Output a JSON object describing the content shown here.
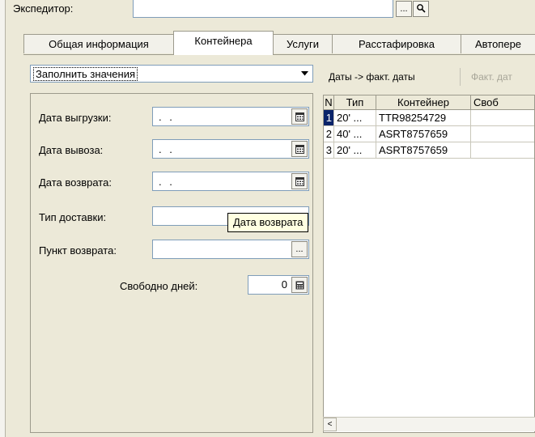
{
  "top": {
    "label": "Экспедитор:",
    "dots_btn": "...",
    "search_icon": "search-icon"
  },
  "tabs": [
    {
      "label": "Общая информация",
      "active": false
    },
    {
      "label": "Контейнера",
      "active": true
    },
    {
      "label": "Услуги",
      "active": false
    },
    {
      "label": "Расстафировка",
      "active": false
    },
    {
      "label": "Автопере",
      "active": false
    }
  ],
  "fill_values": {
    "label": "Заполнить значения"
  },
  "fields": {
    "unload_date": {
      "label": "Дата выгрузки:",
      "value": ". ."
    },
    "export_date": {
      "label": "Дата вывоза:",
      "value": ". ."
    },
    "return_date": {
      "label": "Дата возврата:",
      "value": ". ."
    },
    "delivery_type": {
      "label": "Тип доставки:",
      "value": ""
    },
    "return_point": {
      "label": "Пункт возврата:",
      "value": "",
      "dots": "..."
    },
    "free_days": {
      "label": "Свободно дней:",
      "value": "0"
    }
  },
  "toolbar": {
    "dates_to_fact": "Даты -> факт. даты",
    "fact_dates": "Факт. дат"
  },
  "table": {
    "columns": [
      "N",
      "Тип",
      "Контейнер",
      "Своб"
    ],
    "rows": [
      {
        "n": "1",
        "type": "20' ...",
        "container": "TTR98254729",
        "free": ""
      },
      {
        "n": "2",
        "type": "40' ...",
        "container": "ASRT8757659",
        "free": ""
      },
      {
        "n": "3",
        "type": "20' ...",
        "container": "ASRT8757659",
        "free": ""
      }
    ],
    "scroll_left": "<"
  },
  "tooltip": {
    "text": "Дата возврата"
  },
  "colors": {
    "selection": "#0a246a",
    "input_border": "#7f9db9",
    "panel_bg": "#ece9d8",
    "tooltip_bg": "#ffffe1"
  }
}
